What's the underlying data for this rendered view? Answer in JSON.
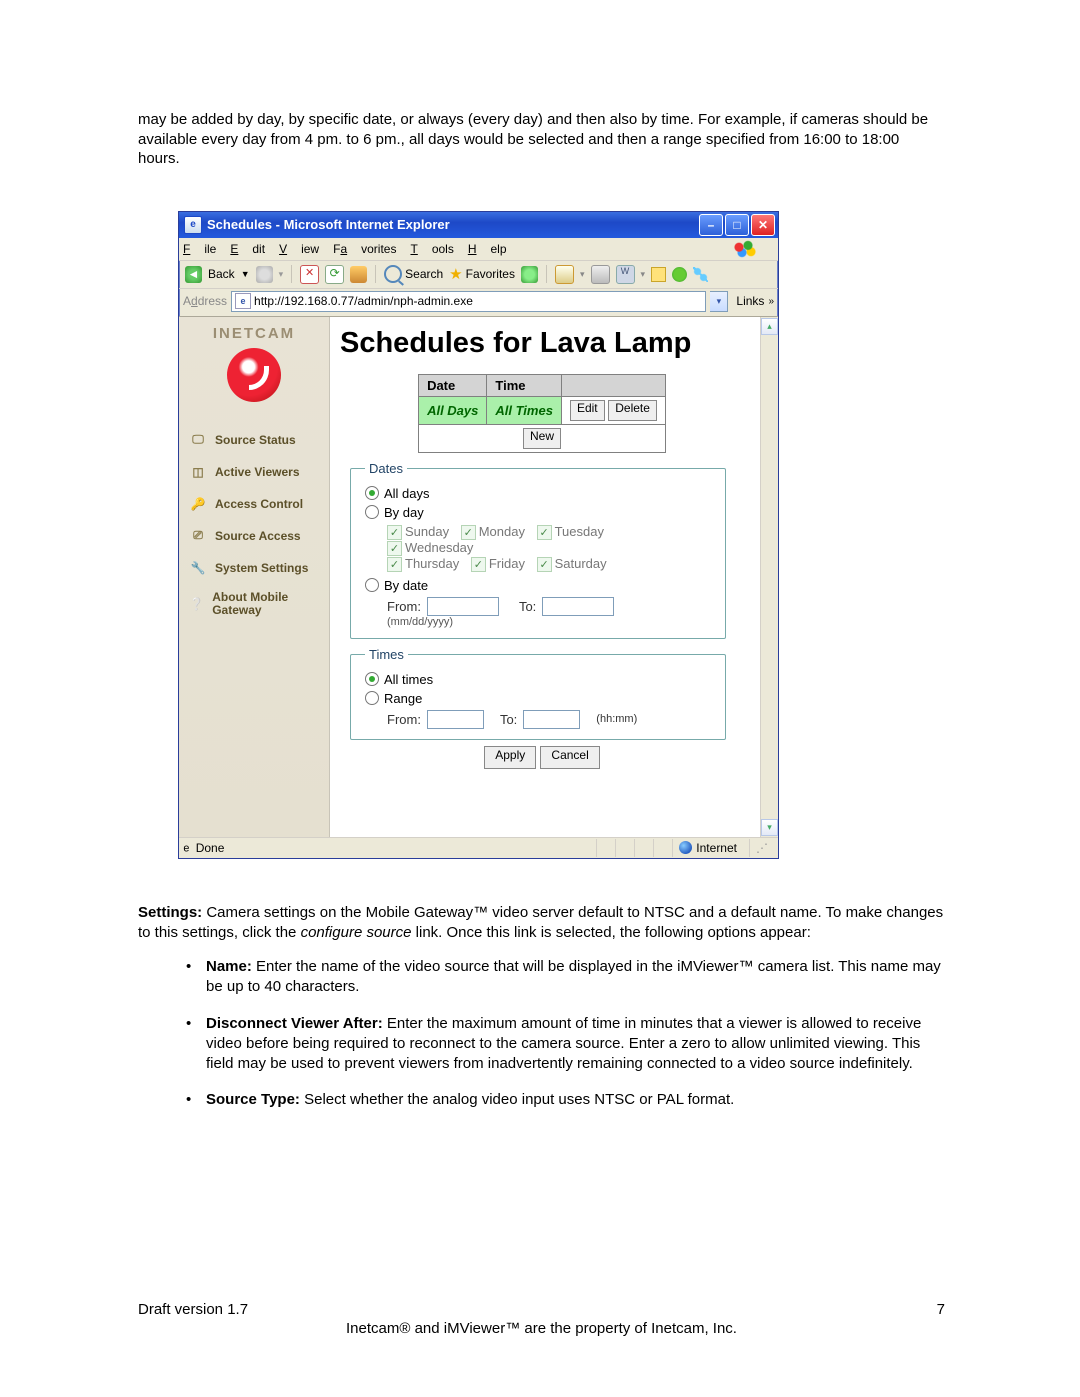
{
  "intro": "may be added by day, by specific date, or always (every day) and then also by time. For example, if cameras should be available every day from 4 pm. to 6 pm., all days would be selected and then a range specified from 16:00 to 18:00 hours.",
  "ie": {
    "title": "Schedules - Microsoft Internet Explorer",
    "menu": {
      "file": "File",
      "edit": "Edit",
      "view": "View",
      "favorites": "Favorites",
      "tools": "Tools",
      "help": "Help"
    },
    "toolbar": {
      "back": "Back",
      "search": "Search",
      "favorites": "Favorites"
    },
    "address": {
      "label": "Address",
      "url": "http://192.168.0.77/admin/nph-admin.exe",
      "links": "Links"
    },
    "status": {
      "done": "Done",
      "zone": "Internet"
    }
  },
  "sidebar": {
    "brand": "INETCAM",
    "items": [
      {
        "label": "Source Status"
      },
      {
        "label": "Active Viewers"
      },
      {
        "label": "Access Control"
      },
      {
        "label": "Source Access"
      },
      {
        "label": "System Settings"
      },
      {
        "label": "About Mobile Gateway"
      }
    ]
  },
  "main": {
    "title": "Schedules for Lava Lamp",
    "table": {
      "headers": {
        "date": "Date",
        "time": "Time"
      },
      "row": {
        "date": "All Days",
        "time": "All Times",
        "edit": "Edit",
        "delete": "Delete"
      },
      "new": "New"
    },
    "dates": {
      "legend": "Dates",
      "all": "All days",
      "byday": "By day",
      "days": {
        "sun": "Sunday",
        "mon": "Monday",
        "tue": "Tuesday",
        "wed": "Wednesday",
        "thu": "Thursday",
        "fri": "Friday",
        "sat": "Saturday"
      },
      "bydate": "By date",
      "from": "From:",
      "to": "To:",
      "fmt": "(mm/dd/yyyy)"
    },
    "times": {
      "legend": "Times",
      "all": "All times",
      "range": "Range",
      "from": "From:",
      "to": "To:",
      "fmt": "(hh:mm)"
    },
    "apply": "Apply",
    "cancel": "Cancel"
  },
  "after": {
    "settings_label": "Settings:",
    "settings_text": "Camera settings on the Mobile Gateway™ video server default to NTSC and a default name. To make changes to this settings, click the ",
    "settings_em": "configure source",
    "settings_text2": " link. Once this link is selected, the following options appear:",
    "items": [
      {
        "label": "Name:",
        "text": "Enter the name of the video source that will be displayed in the iMViewer™ camera list.  This name may be up to 40 characters."
      },
      {
        "label": "Disconnect Viewer After:",
        "text": "Enter the maximum amount of time in minutes that a viewer is allowed to receive video before being required to reconnect to the camera source.  Enter a zero to allow unlimited viewing.  This field may be used to prevent viewers from inadvertently remaining connected to a video source indefinitely."
      },
      {
        "label": "Source Type:",
        "text": "Select whether the analog video input uses NTSC or PAL format."
      }
    ]
  },
  "footer": {
    "version": "Draft version 1.7",
    "page": "7",
    "credit": "Inetcam® and iMViewer™ are the property of Inetcam, Inc."
  }
}
